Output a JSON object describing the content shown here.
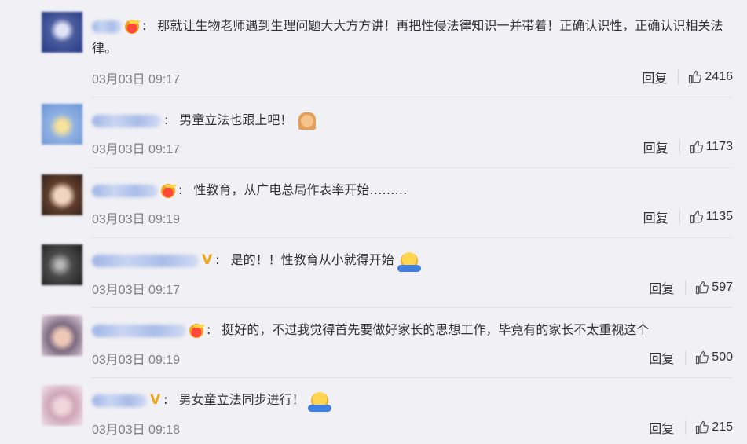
{
  "comments": [
    {
      "text": "那就让生物老师遇到生理问题大大方方讲！再把性侵法律知识一并带着！正确认识性，正确认识相关法律。",
      "time": "03月03日 09:17",
      "reply_label": "回复",
      "likes": "2416",
      "badge": "crown-icon",
      "emoji": ""
    },
    {
      "text": "男童立法也跟上吧！",
      "time": "03月03日 09:17",
      "reply_label": "回复",
      "likes": "1173",
      "badge": "",
      "emoji": "pray-emoji-icon"
    },
    {
      "text": "性教育，从广电总局作表率开始………",
      "time": "03月03日 09:19",
      "reply_label": "回复",
      "likes": "1135",
      "badge": "crown-icon",
      "emoji": ""
    },
    {
      "text": "是的！！性教育从小就得开始",
      "time": "03月03日 09:17",
      "reply_label": "回复",
      "likes": "597",
      "badge": "v-badge-icon",
      "emoji": "shrug-emoji-icon"
    },
    {
      "text": "挺好的，不过我觉得首先要做好家长的思想工作，毕竟有的家长不太重视这个",
      "time": "03月03日 09:19",
      "reply_label": "回复",
      "likes": "500",
      "badge": "crown-icon",
      "emoji": ""
    },
    {
      "text": "男女童立法同步进行！",
      "time": "03月03日 09:18",
      "reply_label": "回复",
      "likes": "215",
      "badge": "v-badge-icon",
      "emoji": "shrug-emoji-icon"
    }
  ],
  "colors": {
    "background": "#f1f0f4",
    "text": "#333333",
    "meta": "#808080",
    "badge_gold": "#f0a51d"
  }
}
